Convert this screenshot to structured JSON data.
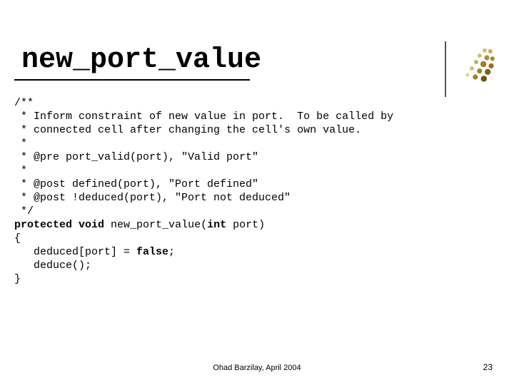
{
  "title": "new_port_value",
  "code": {
    "c1": "/**",
    "c2": " * Inform constraint of new value in port.  To be called by",
    "c3": " * connected cell after changing the cell's own value.",
    "c4": " *",
    "c5": " * @pre port_valid(port), \"Valid port\"",
    "c6": " *",
    "c7": " * @post defined(port), \"Port defined\"",
    "c8": " * @post !deduced(port), \"Port not deduced\"",
    "c9": " */",
    "kw_protected": "protected",
    "kw_void": "void",
    "fn_name": " new_port_value(",
    "kw_int": "int",
    "fn_tail": " port)",
    "brace_open": "{",
    "body1a": "   deduced[port] = ",
    "kw_false": "false",
    "body1b": ";",
    "body2": "   deduce();",
    "brace_close": "}"
  },
  "footer": "Ohad Barzilay, April 2004",
  "page": "23"
}
